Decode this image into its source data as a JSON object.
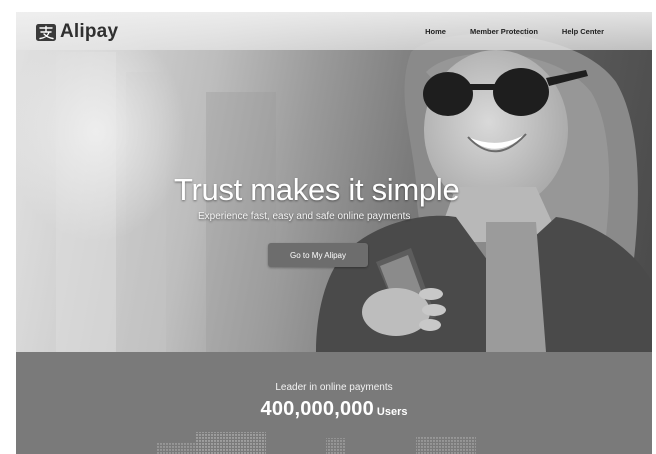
{
  "brand": {
    "name": "Alipay",
    "logo_icon": "alipay-logo-icon"
  },
  "nav": {
    "items": [
      {
        "label": "Home"
      },
      {
        "label": "Member Protection"
      },
      {
        "label": "Help Center"
      }
    ]
  },
  "hero": {
    "title": "Trust makes it simple",
    "subtitle": "Experience fast, easy and safe online payments",
    "cta_label": "Go to My Alipay"
  },
  "stats": {
    "label": "Leader in online payments",
    "number": "400,000,000",
    "unit": "Users"
  },
  "colors": {
    "header_bg": "#eeeeee",
    "cta_bg": "#6d6d6d",
    "stats_bg": "#7a7a7a",
    "text_light": "#ffffff"
  }
}
